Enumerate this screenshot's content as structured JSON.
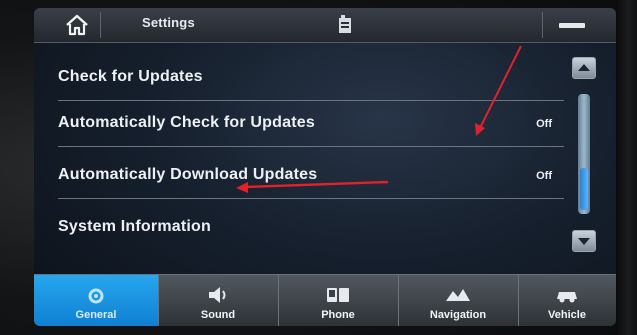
{
  "topbar": {
    "title": "Settings",
    "home_icon": "home-icon",
    "center_icon": "settings-file-icon",
    "status_icon": "status-bar-icon"
  },
  "list": {
    "items": [
      {
        "label": "Check for Updates",
        "value": ""
      },
      {
        "label": "Automatically Check for Updates",
        "value": "Off"
      },
      {
        "label": "Automatically Download Updates",
        "value": "Off"
      },
      {
        "label": "System Information",
        "value": ""
      }
    ]
  },
  "tabs": [
    {
      "label": "General",
      "icon": "gear-icon",
      "active": true
    },
    {
      "label": "Sound",
      "icon": "speaker-icon",
      "active": false
    },
    {
      "label": "Phone",
      "icon": "phone-icon",
      "active": false
    },
    {
      "label": "Navigation",
      "icon": "map-icon",
      "active": false
    },
    {
      "label": "Vehicle",
      "icon": "car-icon",
      "active": false
    }
  ],
  "colors": {
    "active_tab": "#1a92e0",
    "annotation_arrow": "#e0222a"
  }
}
